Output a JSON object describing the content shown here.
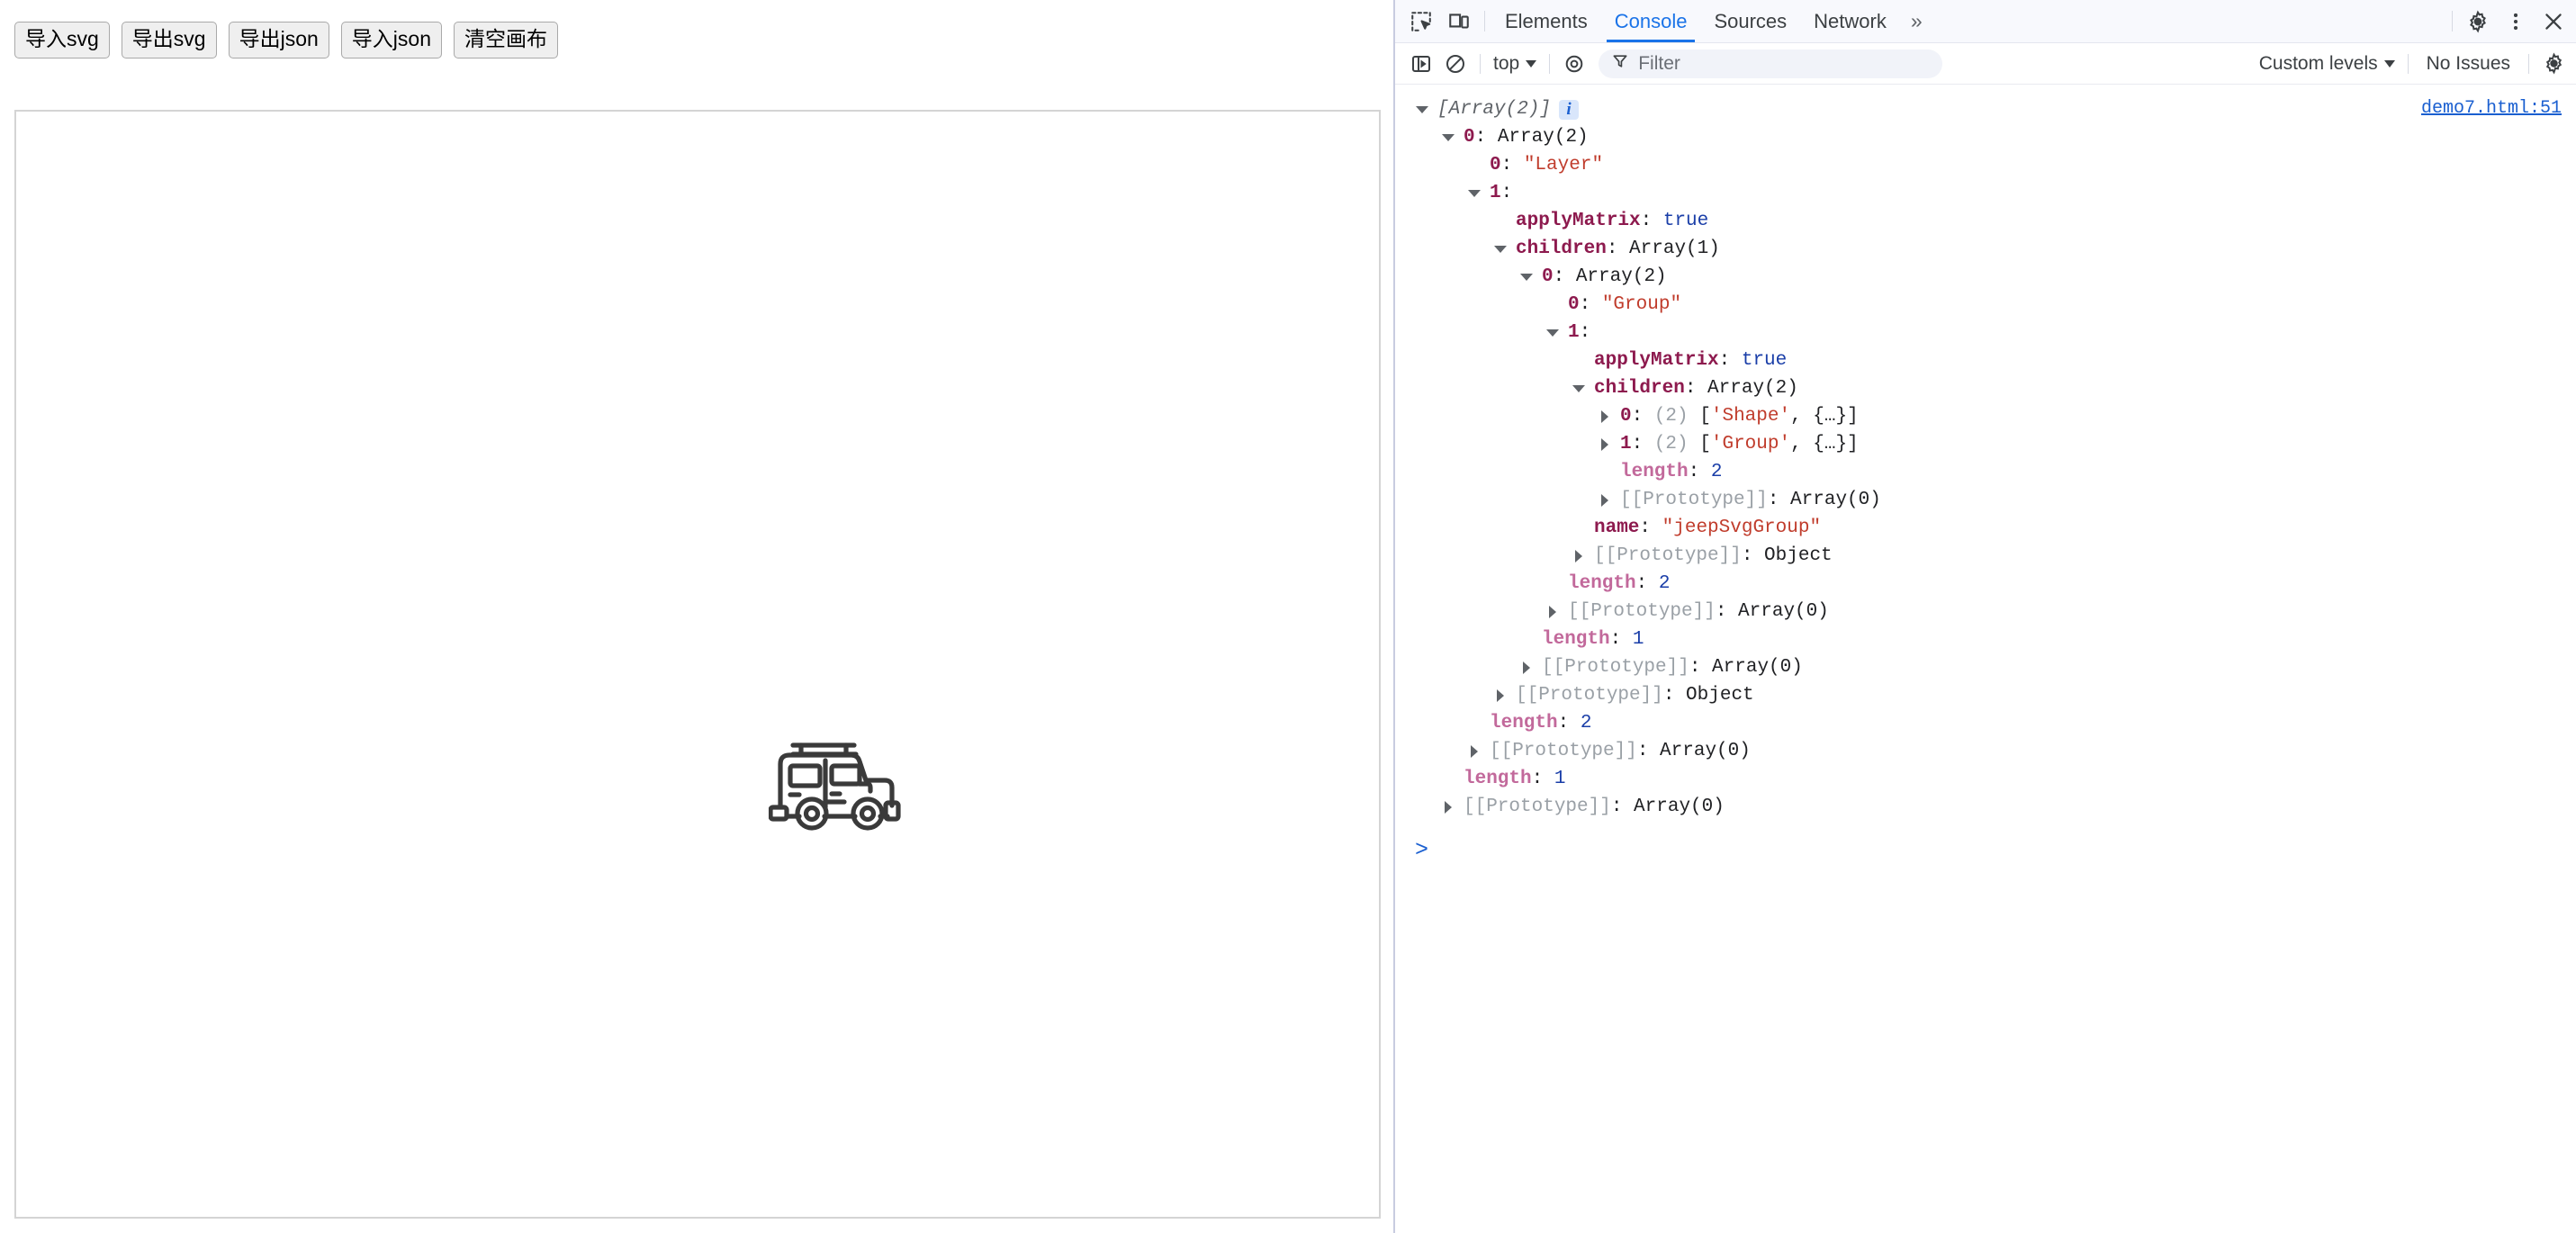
{
  "page": {
    "toolbar_buttons": [
      {
        "name": "import-svg",
        "label": "导入svg"
      },
      {
        "name": "export-svg",
        "label": "导出svg"
      },
      {
        "name": "export-json",
        "label": "导出json"
      },
      {
        "name": "import-json",
        "label": "导入json"
      },
      {
        "name": "clear-canvas",
        "label": "清空画布"
      }
    ],
    "canvas": {
      "artwork_name": "jeep-svg-icon"
    }
  },
  "devtools": {
    "tabs": [
      {
        "label": "Elements",
        "active": false
      },
      {
        "label": "Console",
        "active": true
      },
      {
        "label": "Sources",
        "active": false
      },
      {
        "label": "Network",
        "active": false
      }
    ],
    "more_tabs_label": "»",
    "icons": {
      "inspect": "inspect-element-icon",
      "device": "device-toolbar-icon",
      "settings": "gear-icon",
      "menu": "kebab-menu-icon",
      "close": "close-icon"
    },
    "console_toolbar": {
      "sidebar_toggle": "console-sidebar-toggle-icon",
      "clear": "clear-console-icon",
      "context_label": "top",
      "eye_icon": "live-expression-icon",
      "filter_icon": "filter-funnel-icon",
      "filter_placeholder": "Filter",
      "filter_value": "",
      "levels_label": "Custom levels",
      "issues_label": "No Issues",
      "settings_icon": "gear-icon"
    },
    "console": {
      "source_link": "demo7.html:51",
      "info_badge": "i",
      "prompt": ">",
      "lines": [
        {
          "indent": 0,
          "tri": "open",
          "tokens": [
            {
              "t": "preview",
              "v": "[Array(2)]"
            }
          ],
          "badge": true
        },
        {
          "indent": 1,
          "tri": "open",
          "tokens": [
            {
              "t": "idx",
              "v": "0"
            },
            {
              "t": "plain",
              "v": ": "
            },
            {
              "t": "plain",
              "v": "Array(2)"
            }
          ]
        },
        {
          "indent": 2,
          "tri": "none",
          "tokens": [
            {
              "t": "idx",
              "v": "0"
            },
            {
              "t": "plain",
              "v": ": "
            },
            {
              "t": "str",
              "v": "\"Layer\""
            }
          ]
        },
        {
          "indent": 2,
          "tri": "open",
          "tokens": [
            {
              "t": "idx",
              "v": "1"
            },
            {
              "t": "plain",
              "v": ":"
            }
          ]
        },
        {
          "indent": 3,
          "tri": "none",
          "tokens": [
            {
              "t": "key",
              "v": "applyMatrix"
            },
            {
              "t": "plain",
              "v": ": "
            },
            {
              "t": "bool",
              "v": "true"
            }
          ]
        },
        {
          "indent": 3,
          "tri": "open",
          "tokens": [
            {
              "t": "key",
              "v": "children"
            },
            {
              "t": "plain",
              "v": ": "
            },
            {
              "t": "plain",
              "v": "Array(1)"
            }
          ]
        },
        {
          "indent": 4,
          "tri": "open",
          "tokens": [
            {
              "t": "idx",
              "v": "0"
            },
            {
              "t": "plain",
              "v": ": "
            },
            {
              "t": "plain",
              "v": "Array(2)"
            }
          ]
        },
        {
          "indent": 5,
          "tri": "none",
          "tokens": [
            {
              "t": "idx",
              "v": "0"
            },
            {
              "t": "plain",
              "v": ": "
            },
            {
              "t": "str",
              "v": "\"Group\""
            }
          ]
        },
        {
          "indent": 5,
          "tri": "open",
          "tokens": [
            {
              "t": "idx",
              "v": "1"
            },
            {
              "t": "plain",
              "v": ":"
            }
          ]
        },
        {
          "indent": 6,
          "tri": "none",
          "tokens": [
            {
              "t": "key",
              "v": "applyMatrix"
            },
            {
              "t": "plain",
              "v": ": "
            },
            {
              "t": "bool",
              "v": "true"
            }
          ]
        },
        {
          "indent": 6,
          "tri": "open",
          "tokens": [
            {
              "t": "key",
              "v": "children"
            },
            {
              "t": "plain",
              "v": ": "
            },
            {
              "t": "plain",
              "v": "Array(2)"
            }
          ]
        },
        {
          "indent": 7,
          "tri": "closed",
          "tokens": [
            {
              "t": "idx",
              "v": "0"
            },
            {
              "t": "plain",
              "v": ": "
            },
            {
              "t": "dim",
              "v": "(2) "
            },
            {
              "t": "plain",
              "v": "["
            },
            {
              "t": "str",
              "v": "'Shape'"
            },
            {
              "t": "plain",
              "v": ", {…}]"
            }
          ]
        },
        {
          "indent": 7,
          "tri": "closed",
          "tokens": [
            {
              "t": "idx",
              "v": "1"
            },
            {
              "t": "plain",
              "v": ": "
            },
            {
              "t": "dim",
              "v": "(2) "
            },
            {
              "t": "plain",
              "v": "["
            },
            {
              "t": "str",
              "v": "'Group'"
            },
            {
              "t": "plain",
              "v": ", {…}]"
            }
          ]
        },
        {
          "indent": 7,
          "tri": "none",
          "tokens": [
            {
              "t": "keydim",
              "v": "length"
            },
            {
              "t": "plain",
              "v": ": "
            },
            {
              "t": "num",
              "v": "2"
            }
          ]
        },
        {
          "indent": 7,
          "tri": "closed",
          "tokens": [
            {
              "t": "proto",
              "v": "[[Prototype]]"
            },
            {
              "t": "plain",
              "v": ": "
            },
            {
              "t": "plain",
              "v": "Array(0)"
            }
          ]
        },
        {
          "indent": 6,
          "tri": "none",
          "tokens": [
            {
              "t": "key",
              "v": "name"
            },
            {
              "t": "plain",
              "v": ": "
            },
            {
              "t": "str",
              "v": "\"jeepSvgGroup\""
            }
          ]
        },
        {
          "indent": 6,
          "tri": "closed",
          "tokens": [
            {
              "t": "proto",
              "v": "[[Prototype]]"
            },
            {
              "t": "plain",
              "v": ": "
            },
            {
              "t": "plain",
              "v": "Object"
            }
          ]
        },
        {
          "indent": 5,
          "tri": "none",
          "tokens": [
            {
              "t": "keydim",
              "v": "length"
            },
            {
              "t": "plain",
              "v": ": "
            },
            {
              "t": "num",
              "v": "2"
            }
          ]
        },
        {
          "indent": 5,
          "tri": "closed",
          "tokens": [
            {
              "t": "proto",
              "v": "[[Prototype]]"
            },
            {
              "t": "plain",
              "v": ": "
            },
            {
              "t": "plain",
              "v": "Array(0)"
            }
          ]
        },
        {
          "indent": 4,
          "tri": "none",
          "tokens": [
            {
              "t": "keydim",
              "v": "length"
            },
            {
              "t": "plain",
              "v": ": "
            },
            {
              "t": "num",
              "v": "1"
            }
          ]
        },
        {
          "indent": 4,
          "tri": "closed",
          "tokens": [
            {
              "t": "proto",
              "v": "[[Prototype]]"
            },
            {
              "t": "plain",
              "v": ": "
            },
            {
              "t": "plain",
              "v": "Array(0)"
            }
          ]
        },
        {
          "indent": 3,
          "tri": "closed",
          "tokens": [
            {
              "t": "proto",
              "v": "[[Prototype]]"
            },
            {
              "t": "plain",
              "v": ": "
            },
            {
              "t": "plain",
              "v": "Object"
            }
          ]
        },
        {
          "indent": 2,
          "tri": "none",
          "tokens": [
            {
              "t": "keydim",
              "v": "length"
            },
            {
              "t": "plain",
              "v": ": "
            },
            {
              "t": "num",
              "v": "2"
            }
          ]
        },
        {
          "indent": 2,
          "tri": "closed",
          "tokens": [
            {
              "t": "proto",
              "v": "[[Prototype]]"
            },
            {
              "t": "plain",
              "v": ": "
            },
            {
              "t": "plain",
              "v": "Array(0)"
            }
          ]
        },
        {
          "indent": 1,
          "tri": "none",
          "tokens": [
            {
              "t": "keydim",
              "v": "length"
            },
            {
              "t": "plain",
              "v": ": "
            },
            {
              "t": "num",
              "v": "1"
            }
          ]
        },
        {
          "indent": 1,
          "tri": "closed",
          "tokens": [
            {
              "t": "proto",
              "v": "[[Prototype]]"
            },
            {
              "t": "plain",
              "v": ": "
            },
            {
              "t": "plain",
              "v": "Array(0)"
            }
          ]
        }
      ]
    }
  },
  "colors": {
    "accent": "#1a73e8",
    "link": "#1a5fd0",
    "string": "#c03c2c",
    "number": "#1a3ea8",
    "key": "#8d1a4e",
    "key_dim": "#c2699b",
    "proto": "#9aa0a6",
    "canvas_border": "#d4d4d4",
    "button_face": "#efefef"
  }
}
